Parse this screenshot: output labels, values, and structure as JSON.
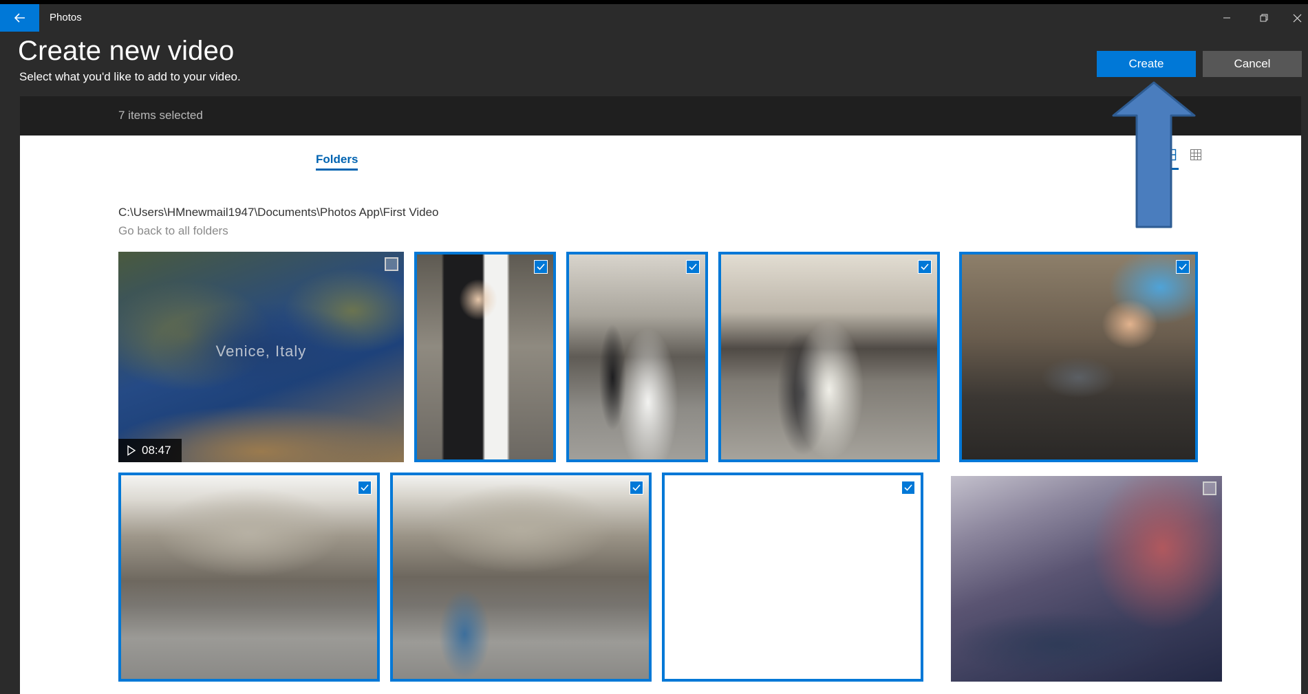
{
  "titlebar": {
    "app_name": "Photos",
    "back_icon": "back-arrow-icon",
    "controls": [
      "minimize-icon",
      "restore-icon",
      "close-icon"
    ]
  },
  "header": {
    "title": "Create new video",
    "subtitle": "Select what you'd like to add to your video.",
    "create_label": "Create",
    "cancel_label": "Cancel"
  },
  "selection": {
    "count_text": "7 items selected"
  },
  "content": {
    "tab_label": "Folders",
    "view_icons": [
      "large-grid-icon",
      "small-grid-icon"
    ],
    "folder_path": "C:\\Users\\HMnewmail1947\\Documents\\Photos App\\First Video",
    "back_link": "Go back to all folders"
  },
  "items": [
    {
      "kind": "video",
      "map_label": "Venice, Italy",
      "duration": "08:47",
      "selected": false
    },
    {
      "kind": "photo",
      "selected": true
    },
    {
      "kind": "photo",
      "selected": true
    },
    {
      "kind": "photo",
      "selected": true
    },
    {
      "kind": "photo",
      "selected": true
    },
    {
      "kind": "photo",
      "selected": true
    },
    {
      "kind": "photo",
      "selected": true
    },
    {
      "kind": "photo",
      "selected": true
    },
    {
      "kind": "photo",
      "selected": false
    }
  ],
  "colors": {
    "accent": "#0078d7",
    "chrome": "#2b2b2b",
    "selection_bar": "#1f1f1f",
    "annotation_arrow": "#4a7dbe"
  }
}
